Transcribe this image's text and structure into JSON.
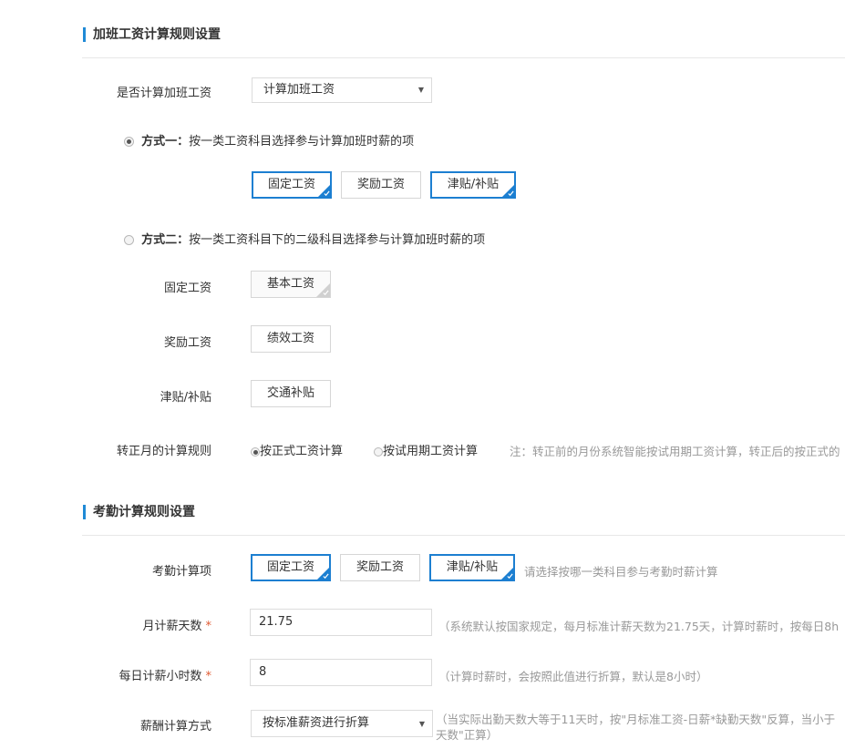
{
  "overtime": {
    "section_title": "加班工资计算规则设置",
    "calc_label": "是否计算加班工资",
    "calc_value": "计算加班工资",
    "method1": {
      "prefix": "方式一：",
      "text": "按一类工资科目选择参与计算加班时薪的项",
      "selected": true,
      "chips": [
        {
          "label": "固定工资",
          "selected": true
        },
        {
          "label": "奖励工资",
          "selected": false
        },
        {
          "label": "津贴/补贴",
          "selected": true
        }
      ]
    },
    "method2": {
      "prefix": "方式二：",
      "text": "按一类工资科目下的二级科目选择参与计算加班时薪的项",
      "selected": false,
      "groups": [
        {
          "label": "固定工资",
          "chip": "基本工资"
        },
        {
          "label": "奖励工资",
          "chip": "绩效工资"
        },
        {
          "label": "津贴/补贴",
          "chip": "交通补贴"
        }
      ]
    },
    "regular_label": "转正月的计算规则",
    "regular_options": [
      {
        "label": "按正式工资计算",
        "selected": true
      },
      {
        "label": "按试用期工资计算",
        "selected": false
      }
    ],
    "regular_note": "注：转正前的月份系统智能按试用期工资计算，转正后的按正式的"
  },
  "attendance": {
    "section_title": "考勤计算规则设置",
    "items_label": "考勤计算项",
    "chips": [
      {
        "label": "固定工资",
        "selected": true
      },
      {
        "label": "奖励工资",
        "selected": false
      },
      {
        "label": "津贴/补贴",
        "selected": true
      }
    ],
    "items_hint": "请选择按哪一类科目参与考勤时薪计算",
    "monthly_label": "月计薪天数",
    "monthly_value": "21.75",
    "monthly_hint": "（系统默认按国家规定，每月标准计薪天数为21.75天，计算时薪时，按每日8h",
    "daily_label": "每日计薪小时数",
    "daily_value": "8",
    "daily_hint": "（计算时薪时，会按照此值进行折算，默认是8小时）",
    "salary_label": "薪酬计算方式",
    "salary_value": "按标准薪资进行折算",
    "salary_hint_line1": "（当实际出勤天数大等于11天时，按\"月标准工资-日薪*缺勤天数\"反算，当小于",
    "salary_hint_line2": "天数\"正算）",
    "required_mark": "*"
  },
  "colors": {
    "accent": "#1c7fd1",
    "section_bar": "#1f8ad6",
    "hint": "#999999",
    "required": "#e05a33"
  }
}
